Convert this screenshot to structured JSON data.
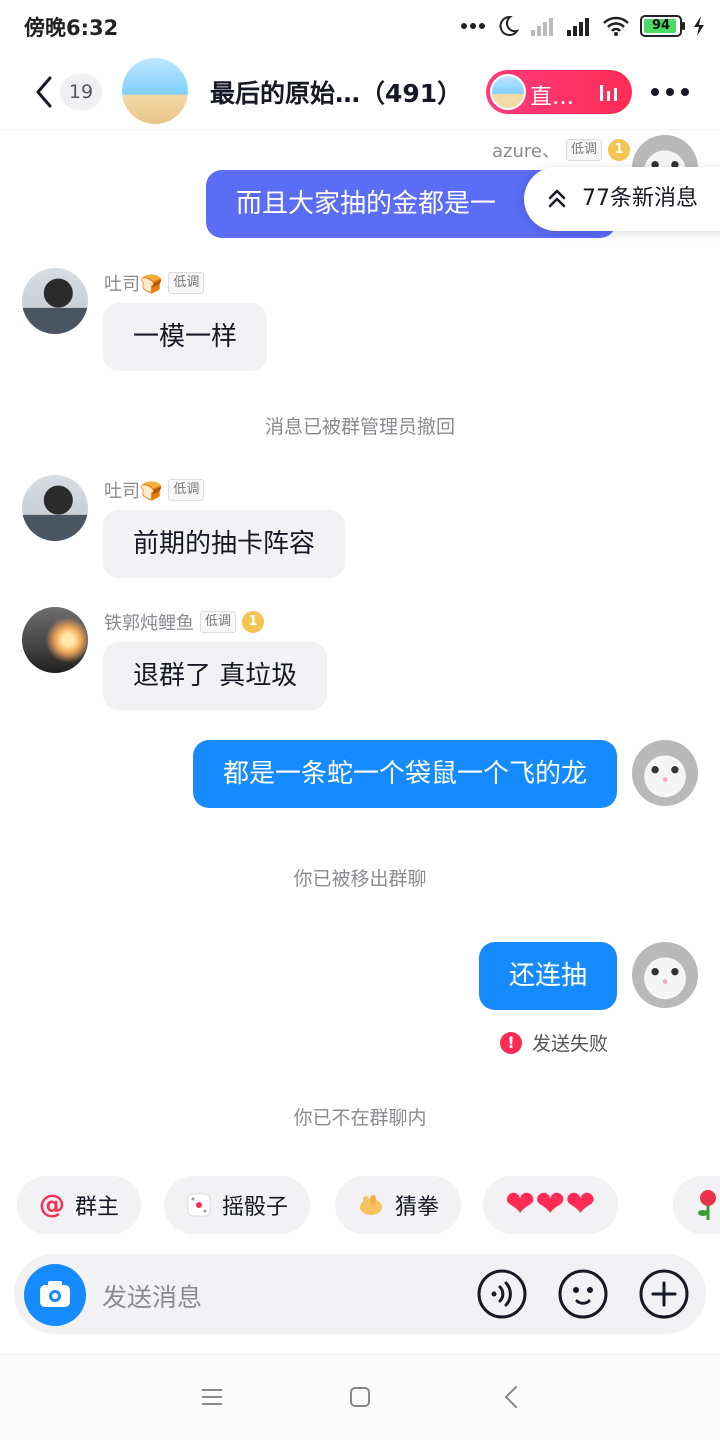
{
  "status_bar": {
    "time": "傍晚6:32",
    "battery": "94",
    "battery_level": 0.94
  },
  "header": {
    "unread_count": "19",
    "title": "最后的原始…（491）",
    "live_label": "直…"
  },
  "chat": {
    "top_sender": {
      "name": "azure、",
      "tag": "低调",
      "medal": "1"
    },
    "top_message": "而且大家抽的金都是一",
    "new_messages": "77条新消息",
    "messages": [
      {
        "sender": "吐司🍞",
        "tag": "低调",
        "text": "一模一样"
      },
      {
        "system": "消息已被群管理员撤回"
      },
      {
        "sender": "吐司🍞",
        "tag": "低调",
        "text": "前期的抽卡阵容"
      },
      {
        "sender": "铁郭炖鲤鱼",
        "tag": "低调",
        "medal": "1",
        "text": "退群了 真垃圾"
      },
      {
        "self": true,
        "text": "都是一条蛇一个袋鼠一个飞的龙"
      },
      {
        "system": "你已被移出群聊"
      },
      {
        "self": true,
        "text": "还连抽",
        "status": "发送失败"
      },
      {
        "system": "你已不在群聊内"
      }
    ]
  },
  "quick_chips": {
    "owner": "群主",
    "dice": "摇骰子",
    "rps": "猜拳",
    "hearts": "❤❤❤",
    "dice_icon": "dice-icon",
    "fist_icon": "fist-icon",
    "rose_icon": "rose-icon"
  },
  "input": {
    "placeholder": "发送消息"
  },
  "colors": {
    "accent": "#168bff",
    "live": "#fe2c55",
    "outgoing_old": "#5b6cf5"
  }
}
